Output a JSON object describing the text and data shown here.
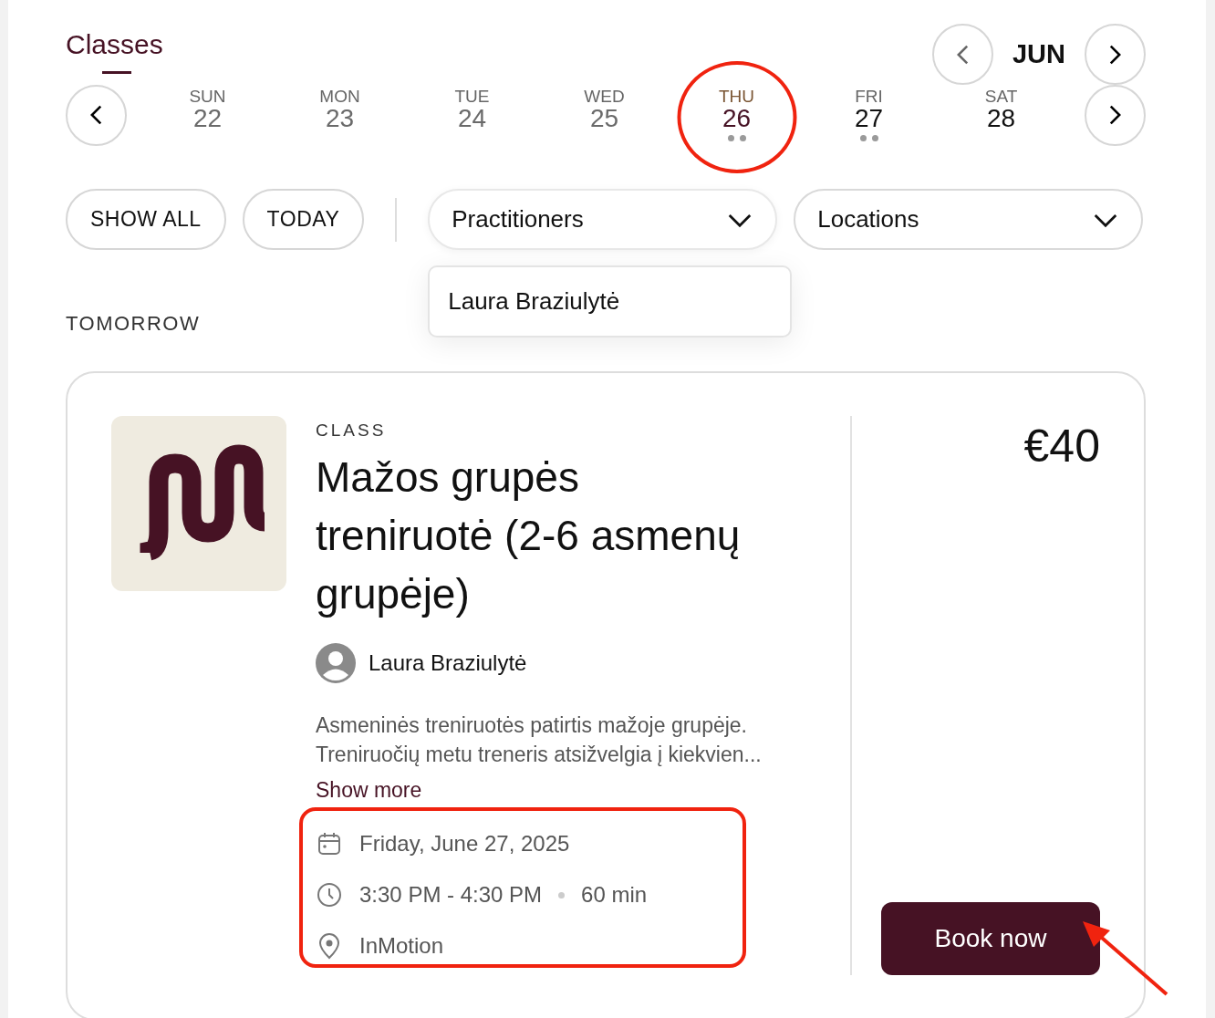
{
  "header": {
    "title": "Classes",
    "selected": true
  },
  "month": {
    "label": "JUN"
  },
  "days": [
    {
      "weekday": "SUN",
      "date": "22",
      "selected": false,
      "disabled": true,
      "has_events": false
    },
    {
      "weekday": "MON",
      "date": "23",
      "selected": false,
      "disabled": true,
      "has_events": false
    },
    {
      "weekday": "TUE",
      "date": "24",
      "selected": false,
      "disabled": true,
      "has_events": false
    },
    {
      "weekday": "WED",
      "date": "25",
      "selected": false,
      "disabled": true,
      "has_events": false
    },
    {
      "weekday": "THU",
      "date": "26",
      "selected": true,
      "disabled": false,
      "has_events": true
    },
    {
      "weekday": "FRI",
      "date": "27",
      "selected": false,
      "disabled": false,
      "has_events": true
    },
    {
      "weekday": "SAT",
      "date": "28",
      "selected": false,
      "disabled": false,
      "has_events": false
    }
  ],
  "filters": {
    "buttons": [
      "SHOW ALL",
      "TODAY"
    ],
    "dropdowns": [
      {
        "label": "Practitioners",
        "expanded": true,
        "options": [
          "Laura Braziulytė"
        ]
      },
      {
        "label": "Locations",
        "expanded": false
      }
    ]
  },
  "section": "TOMORROW",
  "classes": [
    {
      "category": "CLASS",
      "title": "Mažos grupės treniruotė (2-6 asmenų grupėje)",
      "practitioner": "Laura Braziulytė",
      "description": "Asmeninės treniruotės patirtis mažoje grupėje.\nTreniruočių metu treneris atsižvelgia į kiekvien...",
      "show_more": "Show more",
      "date": "Friday, June 27, 2025",
      "time": "3:30 PM - 4:30 PM",
      "duration": "60 min",
      "location": "InMotion",
      "price": "€40",
      "button": "Book now"
    }
  ],
  "annotations": [
    {
      "kind": "circle"
    },
    {
      "kind": "rectangle"
    },
    {
      "kind": "arrow"
    }
  ]
}
